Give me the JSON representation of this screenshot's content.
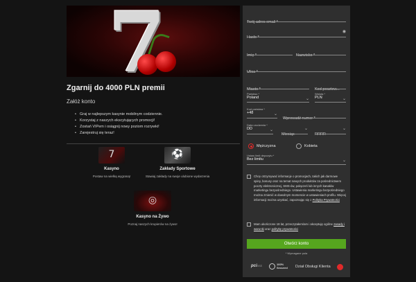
{
  "left": {
    "promo_title": "Zgarnij do 4000 PLN premii",
    "create_title": "Załóż konto",
    "bullets": [
      "Graj w najlepszym kasynie mobilnym codziennie.",
      "Korzystaj z naszych ekscytujących promocji!",
      "Zostań VIPem i osiągnij nowy poziom rozrywki!",
      "Zarejestruj się teraz!"
    ],
    "products": [
      {
        "name": "Kasyno",
        "desc": "Postaw na wielką wygraną!",
        "icon": "slot-seven-icon"
      },
      {
        "name": "Zakłady Sportowe",
        "desc": "Stawiaj zakłady na swoje ulubione wydarzenia",
        "icon": "football-icon"
      },
      {
        "name": "Kasyno na Żywo",
        "desc": "Poznaj naszych krupierów na żywo!",
        "icon": "roulette-icon"
      }
    ]
  },
  "form": {
    "email_label": "Twój adres email *",
    "password_label": "Hasło *",
    "first_name_label": "Imię *",
    "last_name_label": "Nazwisko *",
    "street_label": "Ulica *",
    "city_label": "Miasto *",
    "postal_label": "Kod pocztow...",
    "country_small": "Państwo *",
    "country_value": "Poland",
    "currency_small": "Waluta *",
    "currency_value": "PLN",
    "phone_code_small": "Kod państwa *",
    "phone_code_value": "+48",
    "phone_label": "Wprowadź numer *",
    "dob_small": "Data urodzenia *",
    "dob_day": "DD",
    "dob_month": "Miesiąc",
    "dob_year": "RRRR",
    "gender_male": "Mężczyzna",
    "gender_female": "Kobieta",
    "deposit_small": "Ustaw limit depozytu *",
    "deposit_value": "Bez limitu",
    "consent_marketing_pre": "Chcę otrzymywać informacje o promocjach, takich jak darmowe spiny, bonusy oraz na temat nowych produktów za pośrednictwem poczty elektronicznej, SMS-ów, połączeń lub innych kanałów marketingu bezpośredniego. Ustawienia marketingu bezpośredniego można zmienić w dowolnym momencie w ustawieniach profilu. Więcej informacji można uzyskać, zapoznając się z",
    "consent_marketing_link": "Polityka Prywatności",
    "consent_age_pre": "Mam ukończone 18 lat, przeczytałem/am i akceptuję ogólne",
    "consent_age_link1": "zasady i warunki",
    "consent_age_mid": "oraz",
    "consent_age_link2": "politykę prywatności",
    "submit_label": "Otwórz konto",
    "required_note": "* Wymagane pola"
  },
  "footer": {
    "pci": "pci",
    "pci_sub": "DSS",
    "secured_top": "100%",
    "secured_bottom": "Secured",
    "support": "Dział Obsługi Klienta"
  },
  "colors": {
    "accent_green": "#56a61e",
    "accent_red": "#e02a2a",
    "panel": "#2f2f2f",
    "background": "#141414"
  }
}
